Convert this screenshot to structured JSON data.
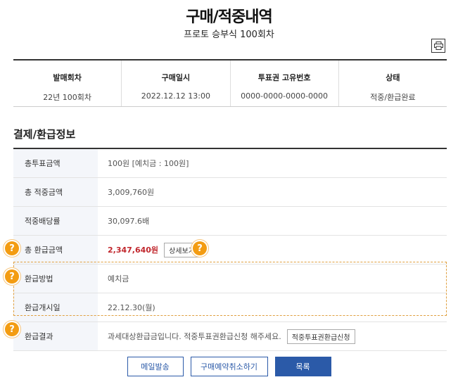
{
  "header": {
    "title": "구매/적중내역",
    "subtitle": "프로토 승부식 100회차"
  },
  "summary": [
    {
      "label": "발매회차",
      "value": "22년 100회차"
    },
    {
      "label": "구매일시",
      "value": "2022.12.12 13:00"
    },
    {
      "label": "투표권 고유번호",
      "value": "0000-0000-0000-0000"
    },
    {
      "label": "상태",
      "value": "적중/환급완료"
    }
  ],
  "section": {
    "title": "결제/환급정보"
  },
  "rows": [
    {
      "label": "총투표금액",
      "value": "100원 [예치금 : 100원]"
    },
    {
      "label": "총 적중금액",
      "value": "3,009,760원"
    },
    {
      "label": "적중배당률",
      "value": "30,097.6배"
    },
    {
      "label": "총 환급금액",
      "value": "2,347,640원",
      "button": "상세보기"
    },
    {
      "label": "환급방법",
      "value": "예치금"
    },
    {
      "label": "환급개시일",
      "value": "22.12.30(월)"
    },
    {
      "label": "환급결과",
      "value": "과세대상환급금입니다. 적중투표권환급신청 해주세요.",
      "button": "적중투표권환급신청"
    }
  ],
  "help_icon": "?",
  "buttons": {
    "mail": "메일발송",
    "cancel": "구매예약취소하기",
    "list": "목록"
  },
  "colors": {
    "accent": "#2b5aa8",
    "highlight": "#c1272d",
    "help": "#f39c12"
  },
  "icons": {
    "print": "printer-icon",
    "help": "question-icon"
  }
}
